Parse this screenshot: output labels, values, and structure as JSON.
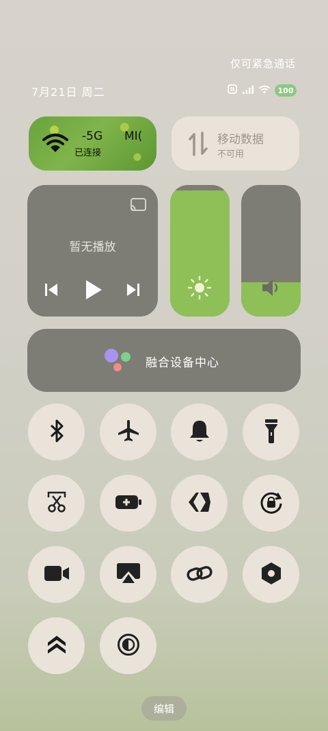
{
  "status_bar": {
    "emergency_text": "仅可紧急通话",
    "date": "7月21日 周二",
    "battery": "100"
  },
  "wifi": {
    "name_left": "-5G",
    "name_right": "MI(",
    "status": "已连接",
    "icon": "wifi-icon",
    "active": true
  },
  "mobile_data": {
    "title": "移动数据",
    "status": "不可用",
    "icon": "data-arrows-icon",
    "active": false
  },
  "media": {
    "message": "暂无播放",
    "controls": [
      "previous-icon",
      "play-icon",
      "next-icon"
    ],
    "cast_icon": "cast-icon"
  },
  "brightness": {
    "level": 0.96,
    "icon": "sun-icon"
  },
  "volume": {
    "level": 0.26,
    "icon": "speaker-icon"
  },
  "device_hub": {
    "label": "融合设备中心",
    "icon": "hub-dots-icon"
  },
  "toggles": [
    {
      "icon": "bluetooth-icon",
      "active": true
    },
    {
      "icon": "airplane-icon",
      "active": false
    },
    {
      "icon": "bell-icon",
      "active": false
    },
    {
      "icon": "flashlight-icon",
      "active": false
    },
    {
      "icon": "screenshot-scissors-icon",
      "active": false
    },
    {
      "icon": "battery-saver-icon",
      "active": false
    },
    {
      "icon": "nfc-icon",
      "active": false
    },
    {
      "icon": "rotation-lock-icon",
      "active": true
    },
    {
      "icon": "video-camera-icon",
      "active": false
    },
    {
      "icon": "screen-cast-icon",
      "active": false
    },
    {
      "icon": "link-icon",
      "active": false
    },
    {
      "icon": "hexagon-nut-icon",
      "active": false
    },
    {
      "icon": "chevrons-up-icon",
      "active": true
    },
    {
      "icon": "contrast-icon",
      "active": false
    }
  ],
  "edit_label": "编辑",
  "colors": {
    "accent_green": "#8fbf57",
    "tile_gray": "#7d7c75",
    "tile_cream": "#e9e3d9"
  }
}
